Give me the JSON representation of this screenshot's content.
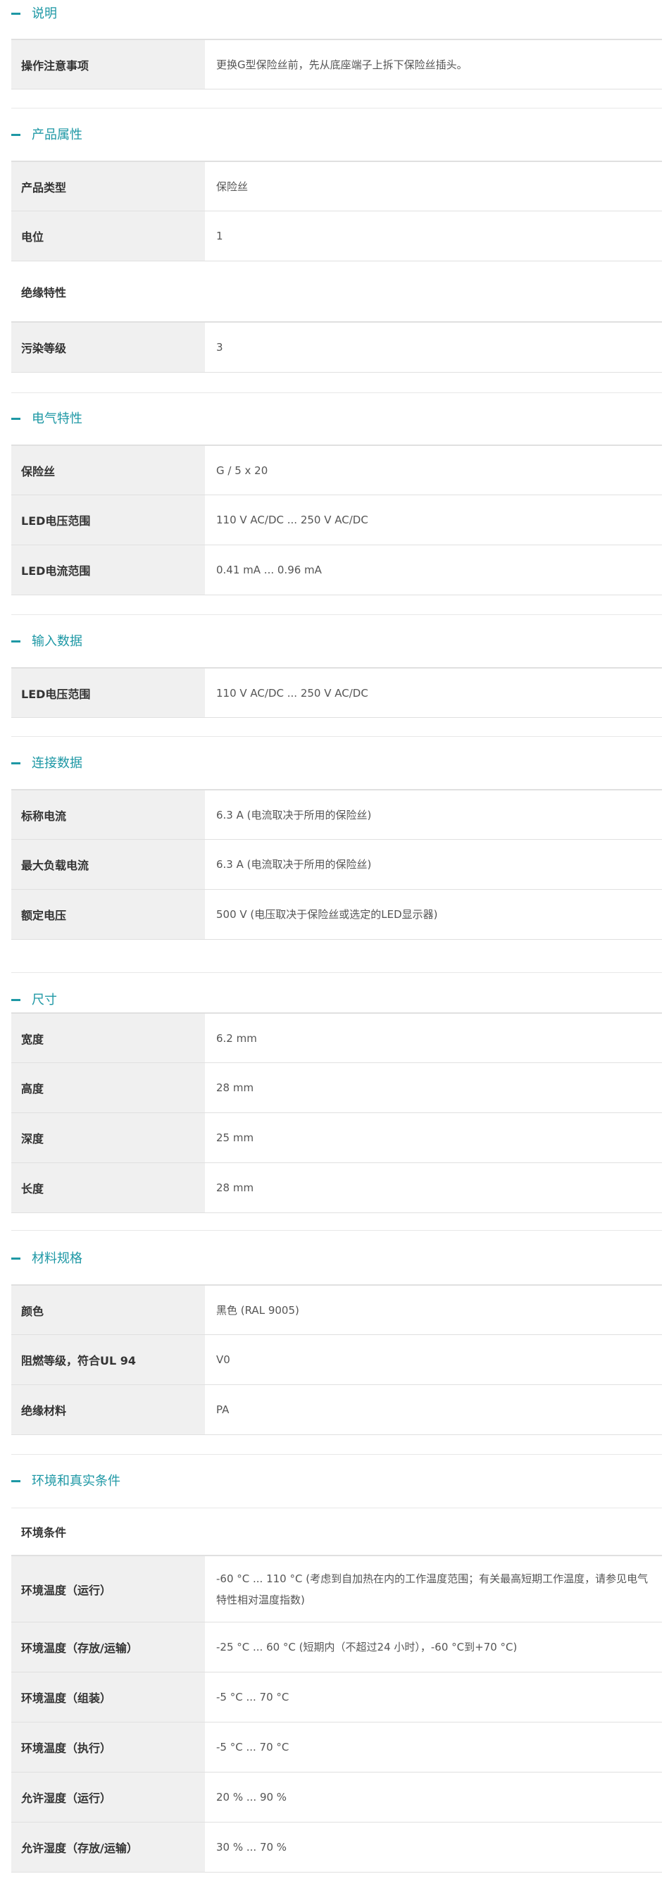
{
  "sections": [
    {
      "title": "说明",
      "rows": [
        {
          "label": "操作注意事项",
          "value": "更换G型保险丝前，先从底座端子上拆下保险丝插头。"
        }
      ]
    },
    {
      "title": "产品属性",
      "rows": [
        {
          "label": "产品类型",
          "value": "保险丝"
        },
        {
          "label": "电位",
          "value": "1"
        }
      ],
      "subgroup": {
        "heading": "绝缘特性",
        "rows": [
          {
            "label": "污染等级",
            "value": "3"
          }
        ]
      }
    },
    {
      "title": "电气特性",
      "rows": [
        {
          "label": "保险丝",
          "value": "G / 5 x 20"
        },
        {
          "label": "LED电压范围",
          "value": "110 V AC/DC ... 250 V AC/DC"
        },
        {
          "label": "LED电流范围",
          "value": "0.41 mA ... 0.96 mA"
        }
      ]
    },
    {
      "title": "输入数据",
      "rows": [
        {
          "label": "LED电压范围",
          "value": "110 V AC/DC ... 250 V AC/DC"
        }
      ]
    },
    {
      "title": "连接数据",
      "rows": [
        {
          "label": "标称电流",
          "value": "6.3 A (电流取决于所用的保险丝)"
        },
        {
          "label": "最大负载电流",
          "value": "6.3 A (电流取决于所用的保险丝)"
        },
        {
          "label": "额定电压",
          "value": "500 V (电压取决于保险丝或选定的LED显示器)"
        }
      ]
    },
    {
      "title": "尺寸",
      "rows": [
        {
          "label": "宽度",
          "value": "6.2 mm"
        },
        {
          "label": "高度",
          "value": "28 mm"
        },
        {
          "label": "深度",
          "value": "25 mm"
        },
        {
          "label": "长度",
          "value": "28 mm"
        }
      ]
    },
    {
      "title": "材料规格",
      "rows": [
        {
          "label": "颜色",
          "value": "黑色 (RAL 9005)"
        },
        {
          "label": "阻燃等级，符合UL 94",
          "value": "V0"
        },
        {
          "label": "绝缘材料",
          "value": "PA"
        }
      ]
    },
    {
      "title": "环境和真实条件",
      "subheading": "环境条件",
      "rows": [
        {
          "label": "环境温度（运行）",
          "value": "-60 °C ... 110 °C (考虑到自加热在内的工作温度范围；有关最高短期工作温度，请参见电气特性相对温度指数)"
        },
        {
          "label": "环境温度（存放/运输）",
          "value": "-25 °C ... 60 °C (短期内（不超过24 小时），-60 °C到+70 °C)"
        },
        {
          "label": "环境温度（组装）",
          "value": "-5 °C ... 70 °C"
        },
        {
          "label": "环境温度（执行）",
          "value": "-5 °C ... 70 °C"
        },
        {
          "label": "允许湿度（运行）",
          "value": "20 % ... 90 %"
        },
        {
          "label": "允许湿度（存放/运输）",
          "value": "30 % ... 70 %"
        }
      ]
    }
  ]
}
